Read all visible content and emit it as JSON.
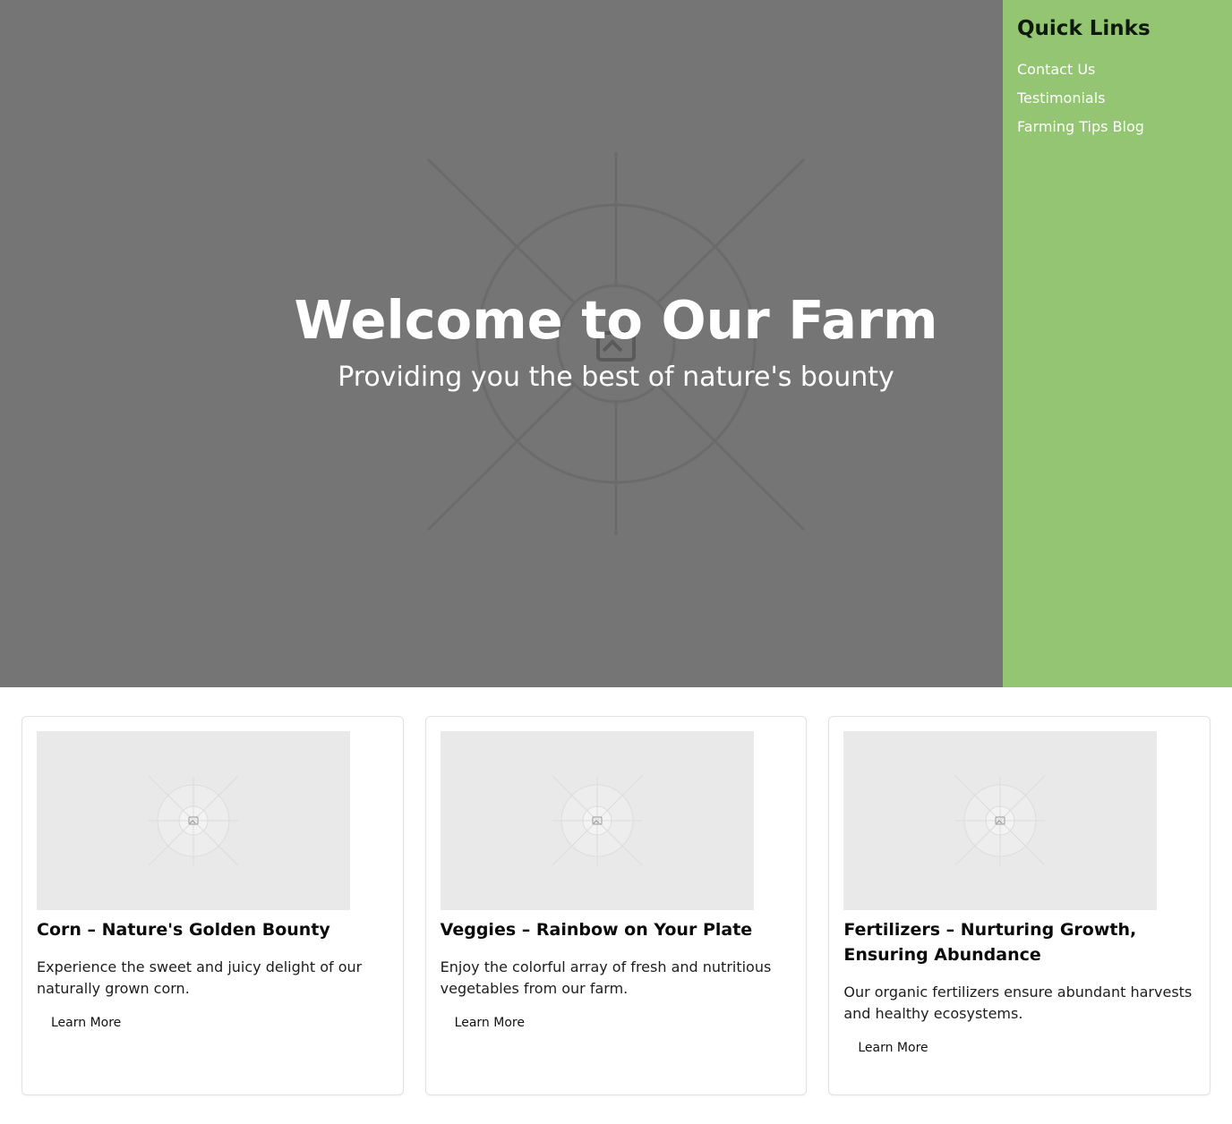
{
  "hero": {
    "title": "Welcome to Our Farm",
    "subtitle": "Providing you the best of nature's bounty",
    "background_color": "#757575",
    "image_icon": "image-placeholder-icon"
  },
  "sidebar": {
    "title": "Quick Links",
    "background_color": "#94c573",
    "links": [
      {
        "label": "Contact Us"
      },
      {
        "label": "Testimonials"
      },
      {
        "label": "Farming Tips Blog"
      }
    ]
  },
  "cards": [
    {
      "title": "Corn – Nature's Golden Bounty",
      "description": "Experience the sweet and juicy delight of our naturally grown corn.",
      "button_label": "Learn More",
      "image_icon": "image-placeholder-icon"
    },
    {
      "title": "Veggies – Rainbow on Your Plate",
      "description": "Enjoy the colorful array of fresh and nutritious vegetables from our farm.",
      "button_label": "Learn More",
      "image_icon": "image-placeholder-icon"
    },
    {
      "title": "Fertilizers – Nurturing Growth, Ensuring Abundance",
      "description": "Our organic fertilizers ensure abundant harvests and healthy ecosystems.",
      "button_label": "Learn More",
      "image_icon": "image-placeholder-icon"
    }
  ]
}
